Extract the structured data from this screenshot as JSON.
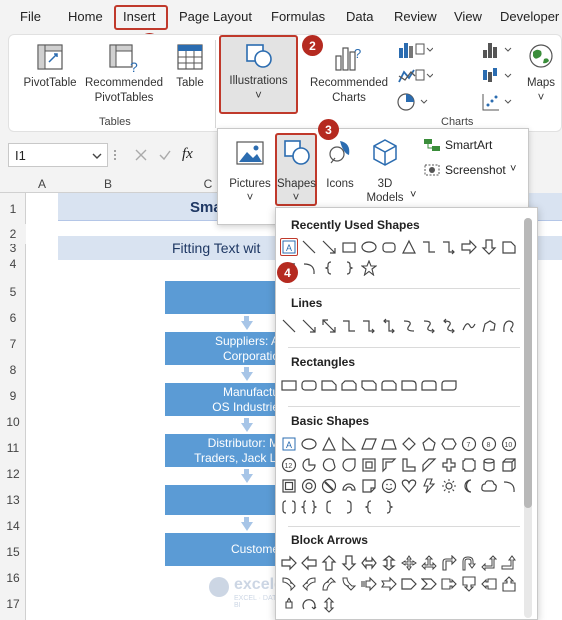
{
  "menu": {
    "items": [
      "File",
      "Home",
      "Insert",
      "Page Layout",
      "Formulas",
      "Data",
      "Review",
      "View",
      "Developer"
    ]
  },
  "ribbon": {
    "pivot_table": "PivotTable",
    "recommended_pivot_line1": "Recommended",
    "recommended_pivot_line2": "PivotTables",
    "table": "Table",
    "tables_group": "Tables",
    "illustrations": "Illustrations",
    "illustrations_chev": "˅",
    "recommended_charts_line1": "Recommended",
    "recommended_charts_line2": "Charts",
    "maps": "Maps",
    "maps_chev": "˅",
    "charts_group": "Charts"
  },
  "formula_bar": {
    "name_box": "I1",
    "fx": "fx"
  },
  "illustrations_menu": {
    "pictures": "Pictures",
    "pictures_chev": "˅",
    "shapes": "Shapes",
    "shapes_chev": "˅",
    "icons": "Icons",
    "models_line1": "3D",
    "models_line2": "Models",
    "models_chev": "˅",
    "smartart": "SmartArt",
    "screenshot": "Screenshot",
    "screenshot_chev": "˅"
  },
  "badges": [
    "1",
    "2",
    "3",
    "4"
  ],
  "sheet": {
    "columns": [
      "A",
      "B",
      "C"
    ],
    "rows": [
      "1",
      "2",
      "3",
      "4",
      "5",
      "6",
      "7",
      "8",
      "9",
      "10",
      "11",
      "12",
      "13",
      "14",
      "15",
      "16",
      "17"
    ],
    "title_text": "Sma",
    "subtitle_text": "Fitting Text wit",
    "flow_boxes": [
      {
        "line1": "",
        "line2": ""
      },
      {
        "line1": "Suppliers: A",
        "line2": "Corporatio"
      },
      {
        "line1": "Manufactu",
        "line2": "OS Industrie"
      },
      {
        "line1": "Distributor: M",
        "line2": "Traders, Jack Li"
      },
      {
        "line1": "",
        "line2": ""
      },
      {
        "line1": "Custome",
        "line2": ""
      }
    ],
    "watermark_name": "exceldemy",
    "watermark_tag": "EXCEL · DATA · BI"
  },
  "shapes_gallery": {
    "sections": [
      "Recently Used Shapes",
      "Lines",
      "Rectangles",
      "Basic Shapes",
      "Block Arrows"
    ],
    "text_box_glyph": "A",
    "basic_numbers": [
      "7",
      "8",
      "10",
      "12"
    ]
  },
  "colors": {
    "accent_red": "#b52a20",
    "excel_blue": "#5b9bd5",
    "header_fill": "#d9e3f1"
  }
}
